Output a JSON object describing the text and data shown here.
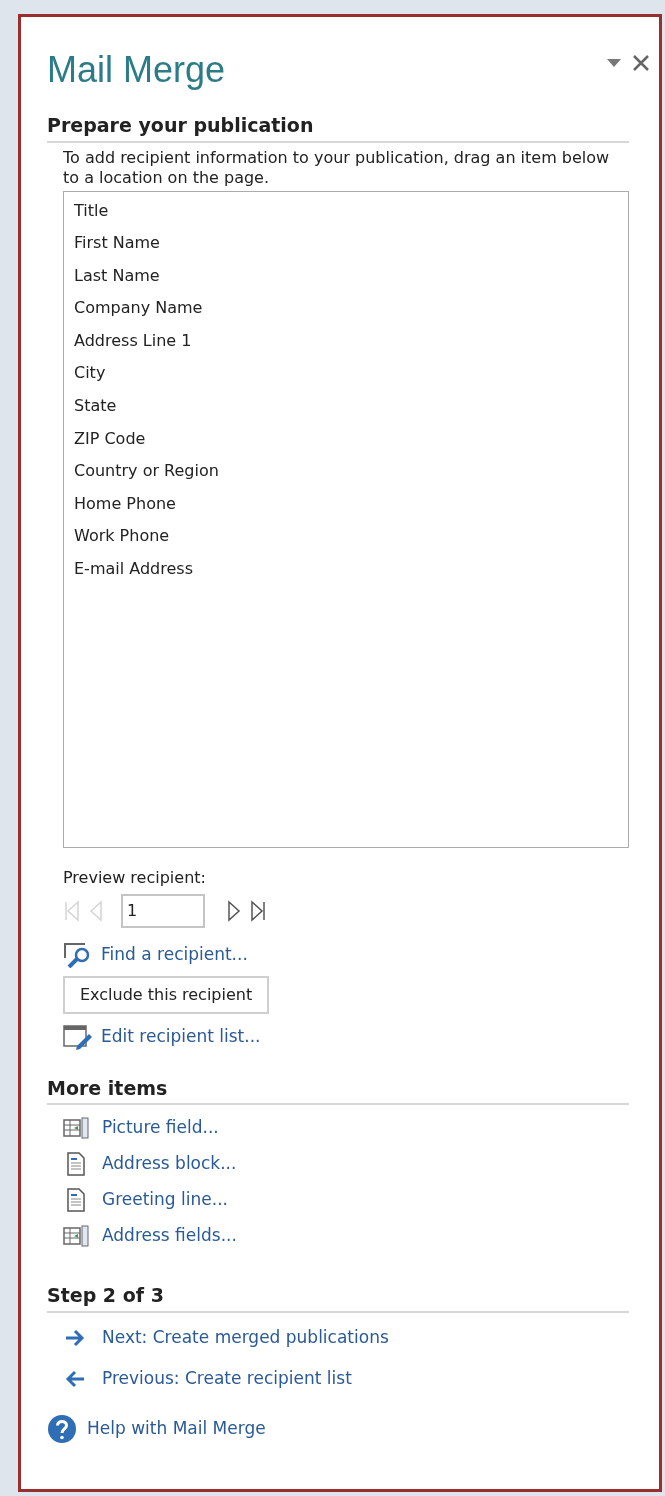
{
  "panel": {
    "title": "Mail Merge"
  },
  "prepare": {
    "heading": "Prepare your publication",
    "instructions": "To add recipient information to your publication, drag an item below to a location on the page.",
    "fields": [
      "Title",
      "First Name",
      "Last Name",
      "Company Name",
      "Address Line 1",
      "City",
      "State",
      "ZIP Code",
      "Country or Region",
      "Home Phone",
      "Work Phone",
      "E-mail Address"
    ]
  },
  "preview": {
    "label": "Preview recipient:",
    "value": "1",
    "nav": [
      {
        "kind": "first",
        "disabled": true
      },
      {
        "kind": "previous",
        "disabled": true
      },
      {
        "kind": "next",
        "disabled": false
      },
      {
        "kind": "last",
        "disabled": false
      }
    ],
    "find_link": "Find a recipient...",
    "exclude_button": "Exclude this recipient",
    "edit_link": "Edit recipient list..."
  },
  "more_items": {
    "heading": "More items",
    "items": [
      {
        "kind": "table",
        "label": "Picture field..."
      },
      {
        "kind": "document",
        "label": "Address block..."
      },
      {
        "kind": "document",
        "label": "Greeting line..."
      },
      {
        "kind": "table",
        "label": "Address fields..."
      }
    ]
  },
  "step": {
    "heading": "Step 2 of 3",
    "links": [
      {
        "kind": "next",
        "label": "Next: Create merged publications"
      },
      {
        "kind": "previous",
        "label": "Previous: Create recipient list"
      }
    ]
  },
  "help_link": "Help with Mail Merge"
}
